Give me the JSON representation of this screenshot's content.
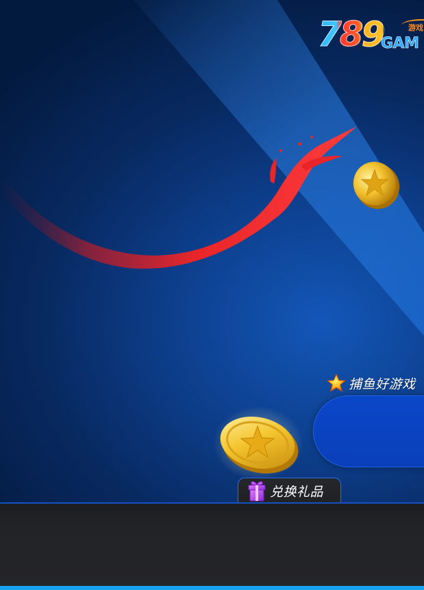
{
  "logo": {
    "number": "789",
    "word": "GAM",
    "tag": "游戏"
  },
  "tagline": {
    "icon": "star-icon",
    "text": "捕鱼好游戏"
  },
  "gift_tab": {
    "icon": "gift-icon",
    "label": "兑换礼品"
  },
  "colors": {
    "background_dark": "#031a3f",
    "background_mid": "#0d3f8d",
    "beam": "#2a7de0",
    "pill_button": "#0a43c2",
    "footer": "#232427",
    "footer_strip": "#17a3ef",
    "accent_red": "#e8262a",
    "coin_gold": "#f2c12e"
  }
}
